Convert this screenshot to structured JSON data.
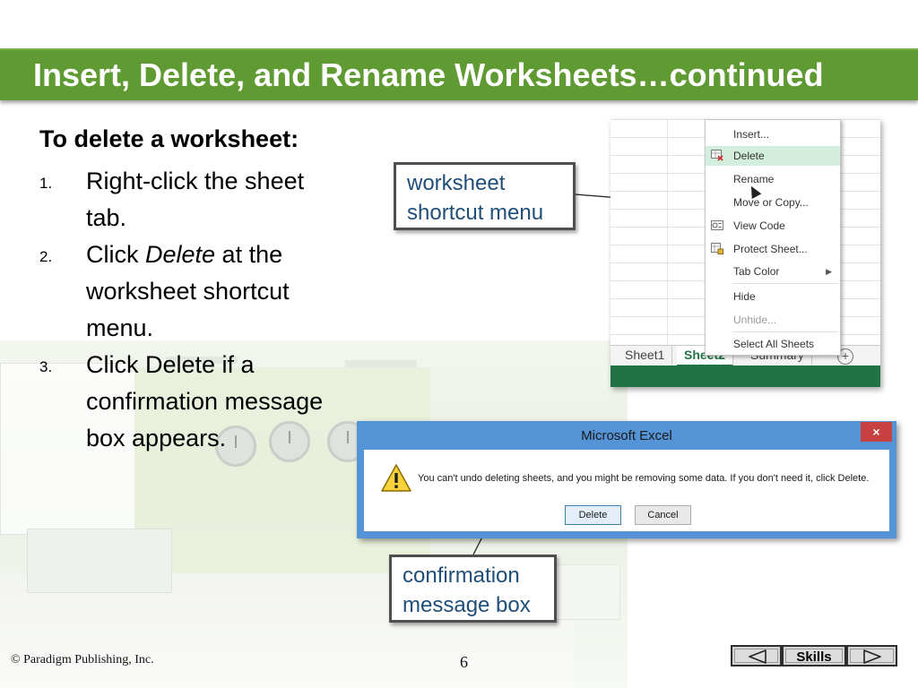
{
  "slide": {
    "title": "Insert, Delete, and Rename Worksheets…continued",
    "heading": "To delete a worksheet:",
    "steps": [
      {
        "num": "1.",
        "text": "Right-click the sheet tab."
      },
      {
        "num": "2.",
        "text_before": "Click ",
        "text_em": "Delete",
        "text_after": " at the worksheet shortcut menu."
      },
      {
        "num": "3.",
        "text": "Click Delete if a confirmation message box appears."
      }
    ]
  },
  "excel": {
    "context_menu": {
      "items": [
        {
          "label": "Insert...",
          "icon": ""
        },
        {
          "label": "Delete",
          "icon": "delete-sheet-icon"
        },
        {
          "label": "Rename",
          "icon": ""
        },
        {
          "label": "Move or Copy...",
          "icon": ""
        },
        {
          "label": "View Code",
          "icon": "view-code-icon"
        },
        {
          "label": "Protect Sheet...",
          "icon": "protect-sheet-icon"
        },
        {
          "label": "Tab Color",
          "icon": ""
        },
        {
          "label": "Hide",
          "icon": ""
        },
        {
          "label": "Unhide...",
          "icon": ""
        },
        {
          "label": "Select All Sheets",
          "icon": ""
        }
      ],
      "highlighted": "Delete",
      "disabled": "Unhide..."
    },
    "sheet_tabs": [
      "Sheet1",
      "Sheet2",
      "Summary"
    ],
    "add_sheet_symbol": "+",
    "status_color": "#217346"
  },
  "callouts": {
    "menu": "worksheet shortcut menu",
    "dialog": "confirmation message box"
  },
  "dialog": {
    "title": "Microsoft Excel",
    "close_symbol": "×",
    "message": "You can't undo deleting sheets, and you might be removing some data. If you don't need it, click Delete.",
    "buttons": {
      "delete": "Delete",
      "cancel": "Cancel"
    }
  },
  "footer": {
    "copyright": "© Paradigm Publishing, Inc.",
    "page_number": "6",
    "skills_label": "Skills"
  },
  "colors": {
    "title_bar": "#609a33",
    "callout_text": "#1f4e79",
    "dialog_frame": "#5393d6",
    "menu_highlight": "#d3eedc"
  }
}
